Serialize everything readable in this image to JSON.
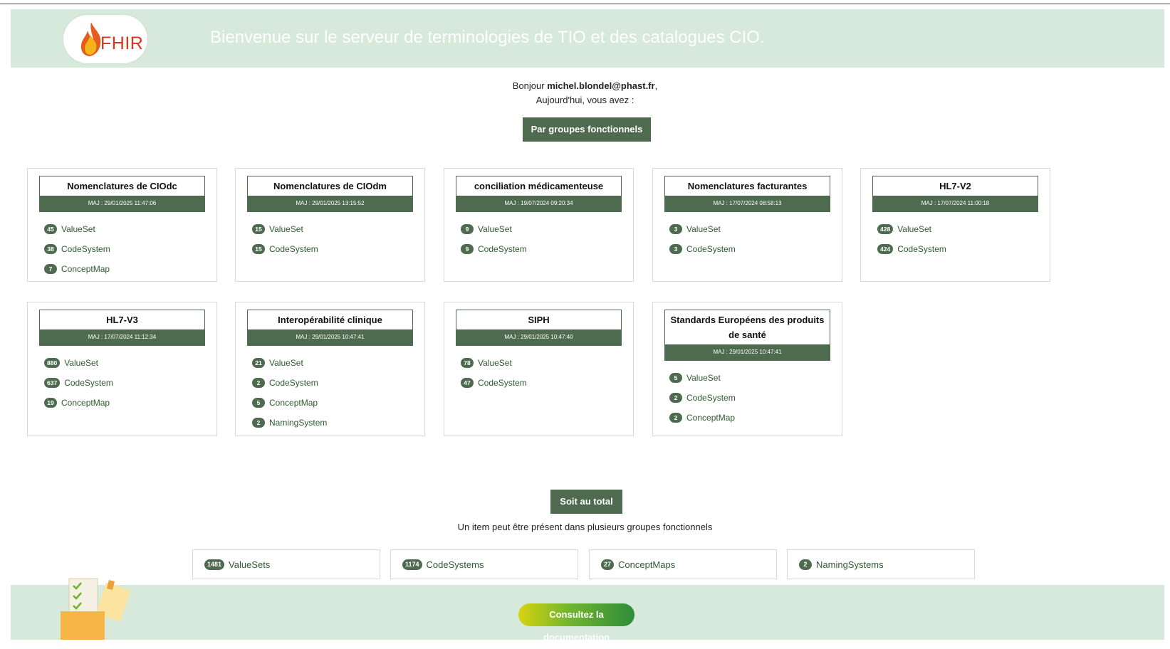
{
  "header": {
    "logo_text": "FHIR",
    "welcome": "Bienvenue sur le serveur de terminologies de TIO et des catalogues CIO."
  },
  "greeting": {
    "prefix": "Bonjour ",
    "user": "michel.blondel@phast.fr",
    "suffix": ",",
    "line2": "Aujourd'hui, vous avez :"
  },
  "group_button": "Par groupes fonctionnels",
  "cards": [
    {
      "title": "Nomenclatures de CIOdc",
      "date": "MAJ : 29/01/2025 11:47:06",
      "items": [
        {
          "count": "45",
          "label": "ValueSet"
        },
        {
          "count": "38",
          "label": "CodeSystem"
        },
        {
          "count": "7",
          "label": "ConceptMap"
        }
      ]
    },
    {
      "title": "Nomenclatures de CIOdm",
      "date": "MAJ : 29/01/2025 13:15:52",
      "items": [
        {
          "count": "15",
          "label": "ValueSet"
        },
        {
          "count": "15",
          "label": "CodeSystem"
        }
      ]
    },
    {
      "title": "conciliation médicamenteuse",
      "date": "MAJ : 19/07/2024 09:20:34",
      "items": [
        {
          "count": "9",
          "label": "ValueSet"
        },
        {
          "count": "9",
          "label": "CodeSystem"
        }
      ]
    },
    {
      "title": "Nomenclatures facturantes",
      "date": "MAJ : 17/07/2024 08:58:13",
      "items": [
        {
          "count": "3",
          "label": "ValueSet"
        },
        {
          "count": "3",
          "label": "CodeSystem"
        }
      ]
    },
    {
      "title": "HL7-V2",
      "date": "MAJ : 17/07/2024 11:00:18",
      "items": [
        {
          "count": "428",
          "label": "ValueSet"
        },
        {
          "count": "424",
          "label": "CodeSystem"
        }
      ]
    },
    {
      "title": "HL7-V3",
      "date": "MAJ : 17/07/2024 11:12:34",
      "items": [
        {
          "count": "880",
          "label": "ValueSet"
        },
        {
          "count": "637",
          "label": "CodeSystem"
        },
        {
          "count": "19",
          "label": "ConceptMap"
        }
      ]
    },
    {
      "title": "Interopérabilité clinique",
      "date": "MAJ : 29/01/2025 10:47:41",
      "items": [
        {
          "count": "21",
          "label": "ValueSet"
        },
        {
          "count": "2",
          "label": "CodeSystem"
        },
        {
          "count": "5",
          "label": "ConceptMap"
        },
        {
          "count": "2",
          "label": "NamingSystem"
        }
      ]
    },
    {
      "title": "SIPH",
      "date": "MAJ : 29/01/2025 10:47:40",
      "items": [
        {
          "count": "78",
          "label": "ValueSet"
        },
        {
          "count": "47",
          "label": "CodeSystem"
        }
      ]
    },
    {
      "title": "Standards Européens des produits de santé",
      "date": "MAJ : 29/01/2025 10:47:41",
      "items": [
        {
          "count": "5",
          "label": "ValueSet"
        },
        {
          "count": "2",
          "label": "CodeSystem"
        },
        {
          "count": "2",
          "label": "ConceptMap"
        }
      ]
    }
  ],
  "total_button": "Soit au total",
  "total_note": "Un item peut être présent dans plusieurs groupes fonctionnels",
  "totals": [
    {
      "count": "1481",
      "label": "ValueSets"
    },
    {
      "count": "1174",
      "label": "CodeSystems"
    },
    {
      "count": "27",
      "label": "ConceptMaps"
    },
    {
      "count": "2",
      "label": "NamingSystems"
    }
  ],
  "footer": {
    "doc_button": "Consultez la documentation"
  },
  "colors": {
    "accent": "#4f6b4f",
    "header_bg": "#d6e9db",
    "link": "#2f5a2f",
    "logo_flame": "#d8341f"
  }
}
